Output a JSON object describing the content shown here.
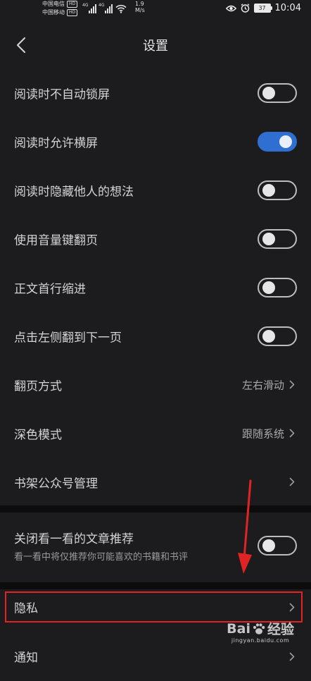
{
  "status_bar": {
    "carrier_1": "中国电信",
    "carrier_2": "中国移动",
    "hd_label": "HD",
    "network_tag": "4G",
    "net_speed_value": "1.9",
    "net_speed_unit": "M/s",
    "battery_level": "37",
    "time": "10:04"
  },
  "nav": {
    "title": "设置"
  },
  "settings": {
    "items": [
      {
        "label": "阅读时不自动锁屏",
        "type": "toggle",
        "on": false
      },
      {
        "label": "阅读时允许横屏",
        "type": "toggle",
        "on": true
      },
      {
        "label": "阅读时隐藏他人的想法",
        "type": "toggle",
        "on": false
      },
      {
        "label": "使用音量键翻页",
        "type": "toggle",
        "on": false
      },
      {
        "label": "正文首行缩进",
        "type": "toggle",
        "on": false
      },
      {
        "label": "点击左侧翻到下一页",
        "type": "toggle",
        "on": false
      },
      {
        "label": "翻页方式",
        "type": "link",
        "value": "左右滑动"
      },
      {
        "label": "深色模式",
        "type": "link",
        "value": "跟随系统"
      },
      {
        "label": "书架公众号管理",
        "type": "link",
        "value": ""
      }
    ],
    "recommend": {
      "label": "关闭看一看的文章推荐",
      "sublabel": "看一看中将仅推荐你可能喜欢的书籍和书评",
      "on": false
    },
    "privacy": {
      "label": "隐私"
    },
    "notify": {
      "label": "通知"
    }
  },
  "watermark": {
    "brand": "Bai",
    "brand_suffix": "经验",
    "url": "jingyan.baidu.com"
  },
  "colors": {
    "background": "#1c1c1e",
    "toggle_on": "#2f6fd1",
    "highlight": "#e02424"
  }
}
